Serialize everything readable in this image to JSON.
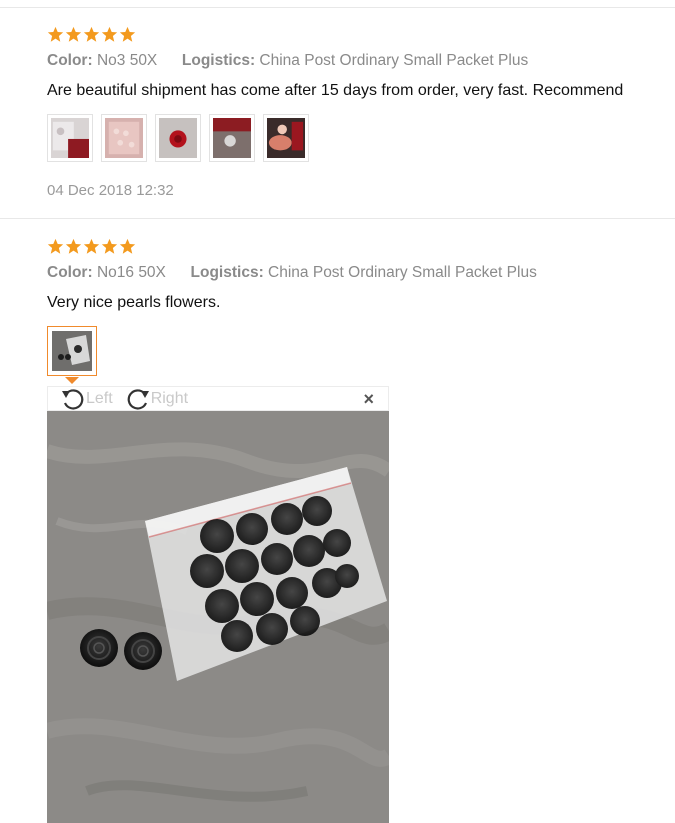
{
  "reviews": [
    {
      "rating": 5,
      "color_label": "Color:",
      "color_value": "No3 50X",
      "logistics_label": "Logistics:",
      "logistics_value": "China Post Ordinary Small Packet Plus",
      "text": "Are beautiful shipment has come after 15 days from order, very fast. Recommend",
      "photo_count": 5,
      "date": "04 Dec 2018 12:32"
    },
    {
      "rating": 5,
      "color_label": "Color:",
      "color_value": "No16 50X",
      "logistics_label": "Logistics:",
      "logistics_value": "China Post Ordinary Small Packet Plus",
      "text": "Very nice pearls flowers.",
      "photo_count": 1
    }
  ],
  "viewer": {
    "rotate_left_label": "Left",
    "rotate_right_label": "Right",
    "close_label": "×"
  },
  "colors": {
    "star": "#f39a1e",
    "accent_border": "#f08a2c"
  }
}
